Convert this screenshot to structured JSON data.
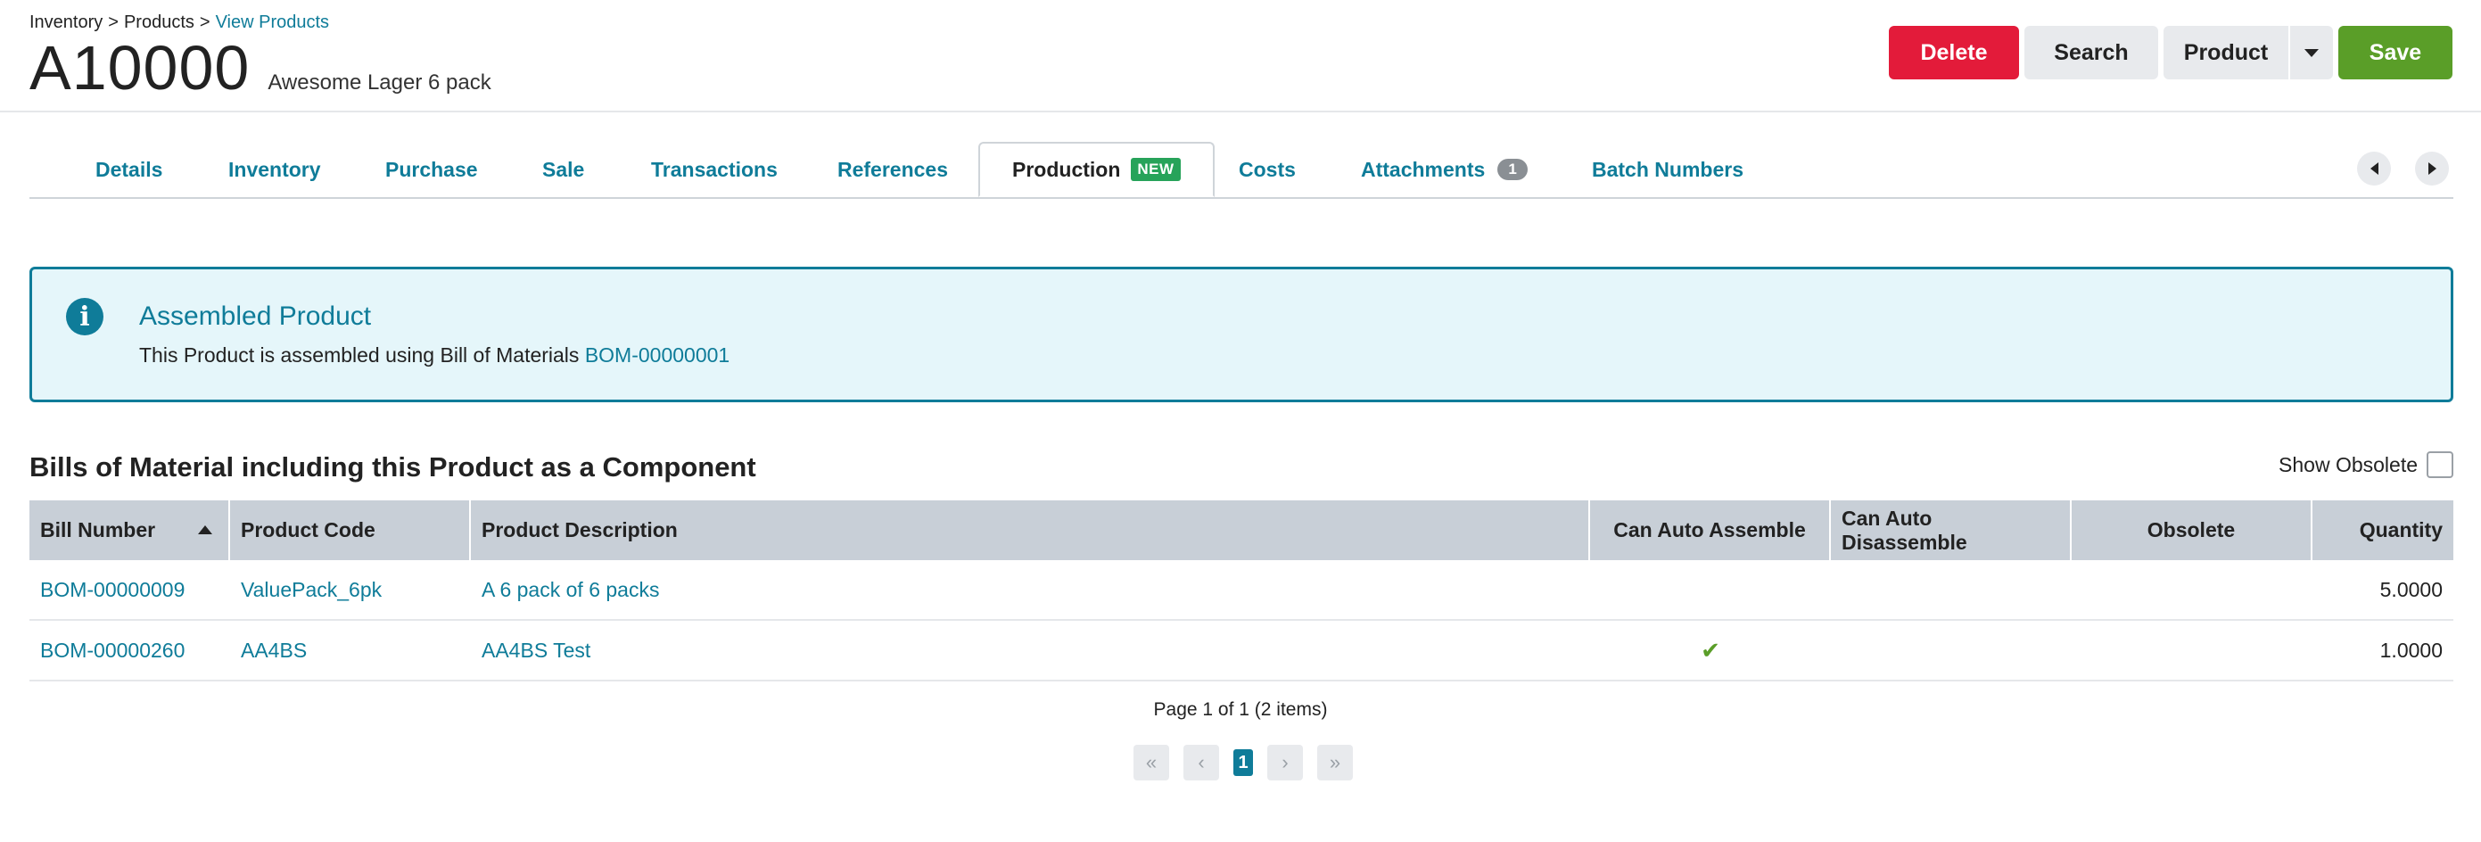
{
  "breadcrumb": {
    "items": [
      "Inventory",
      "Products"
    ],
    "separator": ">",
    "current": "View Products"
  },
  "header": {
    "code": "A10000",
    "description": "Awesome Lager 6 pack"
  },
  "actions": {
    "delete_label": "Delete",
    "search_label": "Search",
    "product_label": "Product",
    "save_label": "Save"
  },
  "tabs": {
    "details": "Details",
    "inventory": "Inventory",
    "purchase": "Purchase",
    "sale": "Sale",
    "transactions": "Transactions",
    "references": "References",
    "production": "Production",
    "production_badge": "NEW",
    "costs": "Costs",
    "attachments": "Attachments",
    "attachments_count": "1",
    "batch_numbers": "Batch Numbers"
  },
  "info": {
    "icon": "info-icon",
    "title": "Assembled Product",
    "text": "This Product is assembled using Bill of Materials",
    "link": "BOM-00000001"
  },
  "section": {
    "title": "Bills of Material including this Product as a Component",
    "show_obsolete_label": "Show Obsolete"
  },
  "table": {
    "headers": {
      "bill_number": "Bill Number",
      "product_code": "Product Code",
      "product_description": "Product Description",
      "can_auto_assemble": "Can Auto Assemble",
      "can_auto_disassemble": "Can Auto Disassemble",
      "obsolete": "Obsolete",
      "quantity": "Quantity"
    },
    "rows": [
      {
        "bill_number": "BOM-00000009",
        "product_code": "ValuePack_6pk",
        "product_description": "A 6 pack of 6 packs",
        "can_auto_assemble": "",
        "can_auto_disassemble": "",
        "obsolete": "",
        "quantity": "5.0000"
      },
      {
        "bill_number": "BOM-00000260",
        "product_code": "AA4BS",
        "product_description": "AA4BS Test",
        "can_auto_assemble": "✔",
        "can_auto_disassemble": "",
        "obsolete": "",
        "quantity": "1.0000"
      }
    ]
  },
  "pager": {
    "info": "Page 1 of 1 (2 items)",
    "current_page": "1",
    "first": "«",
    "prev": "‹",
    "next": "›",
    "last": "»"
  },
  "colors": {
    "accent": "#0f7c99",
    "delete": "#e31b3a",
    "save": "#5a9e28",
    "badge_new": "#27a35a",
    "info_bg": "#e5f6fa",
    "table_header": "#c8cfd7"
  }
}
